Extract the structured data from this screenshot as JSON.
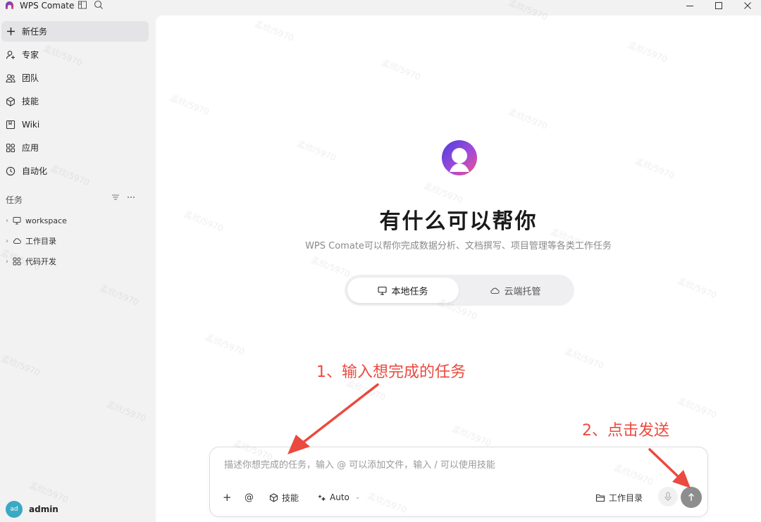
{
  "app": {
    "title": "WPS Comate",
    "brand_color": "#7b4bd8"
  },
  "sidebar": {
    "items": [
      {
        "label": "新任务",
        "icon": "plus-icon",
        "active": true
      },
      {
        "label": "专家",
        "icon": "expert-icon"
      },
      {
        "label": "团队",
        "icon": "team-icon"
      },
      {
        "label": "技能",
        "icon": "cube-icon"
      },
      {
        "label": "Wiki",
        "icon": "book-icon"
      },
      {
        "label": "应用",
        "icon": "apps-icon"
      },
      {
        "label": "自动化",
        "icon": "clock-icon"
      }
    ],
    "tasks_title": "任务",
    "tree": [
      {
        "label": "workspace",
        "icon": "monitor-icon"
      },
      {
        "label": "工作目录",
        "icon": "cloud-icon"
      },
      {
        "label": "代码开发",
        "icon": "apps-icon"
      }
    ],
    "user": {
      "avatar_text": "ad",
      "name": "admin"
    }
  },
  "main": {
    "title": "有什么可以帮你",
    "subtitle": "WPS Comate可以帮你完成数据分析、文档撰写、项目管理等各类工作任务",
    "modes": [
      {
        "label": "本地任务",
        "icon": "monitor-icon",
        "selected": true
      },
      {
        "label": "云端托管",
        "icon": "cloud-icon",
        "selected": false
      }
    ],
    "annotation_1": "1、输入想完成的任务",
    "annotation_2": "2、点击发送",
    "annotation_color": "#ea4a3f",
    "input": {
      "placeholder": "描述你想完成的任务，输入 @ 可以添加文件，输入 / 可以使用技能",
      "value": "",
      "tools": {
        "add": "+",
        "mention": "@",
        "skill": "技能",
        "model": "Auto",
        "workdir": "工作目录"
      }
    }
  },
  "watermark": "孟欣/5970"
}
